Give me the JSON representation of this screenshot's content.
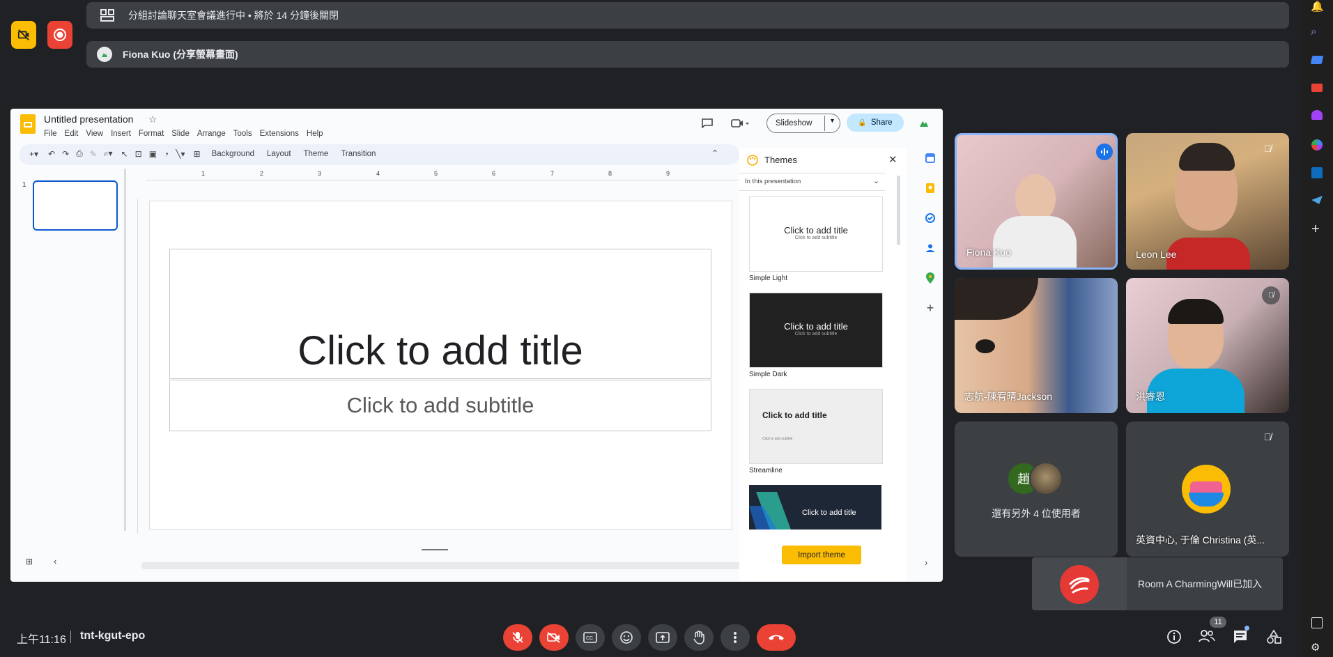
{
  "banners": {
    "breakout": "分組討論聊天室會議進行中 • 將於 14 分鐘後關閉",
    "presenter": "Fiona Kuo (分享螢幕畫面)"
  },
  "slides": {
    "doc_title": "Untitled presentation",
    "menu": [
      "File",
      "Edit",
      "View",
      "Insert",
      "Format",
      "Slide",
      "Arrange",
      "Tools",
      "Extensions",
      "Help"
    ],
    "slideshow_label": "Slideshow",
    "share_label": "Share",
    "toolbar": {
      "background": "Background",
      "layout": "Layout",
      "theme": "Theme",
      "transition": "Transition"
    },
    "ruler_numbers": [
      "1",
      "2",
      "3",
      "4",
      "5",
      "6",
      "7",
      "8",
      "9"
    ],
    "slide_number": "1",
    "title_placeholder": "Click to add title",
    "subtitle_placeholder": "Click to add subtitle",
    "themes_panel": {
      "heading": "Themes",
      "filter": "In this presentation",
      "themes": [
        {
          "name": "Simple Light",
          "title": "Click to add title",
          "sub": "Click to add subtitle"
        },
        {
          "name": "Simple Dark",
          "title": "Click to add title",
          "sub": "Click to add subtitle"
        },
        {
          "name": "Streamline",
          "title": "Click to add title",
          "sub": "Click to add subtitle"
        },
        {
          "name": "",
          "title": "Click to add title",
          "sub": ""
        }
      ],
      "import_label": "Import theme"
    }
  },
  "participants": [
    {
      "name": "Fiona Kuo"
    },
    {
      "name": "Leon Lee"
    },
    {
      "name": "志航-陳宥晴Jackson"
    },
    {
      "name": "洪睿恩"
    },
    {
      "name": "還有另外 4 位使用者",
      "avatar_letter": "趙"
    },
    {
      "name": "英資中心, 于倫 Christina (英..."
    }
  ],
  "toast": {
    "text": "Room A CharmingWill已加入"
  },
  "bottom": {
    "time": "上午11:16",
    "meeting_code": "tnt-kgut-epo",
    "people_count": "11"
  },
  "colors": {
    "bg": "#202124",
    "red": "#ea4335",
    "blue": "#8ab4f8",
    "yellow": "#fbbc04"
  }
}
